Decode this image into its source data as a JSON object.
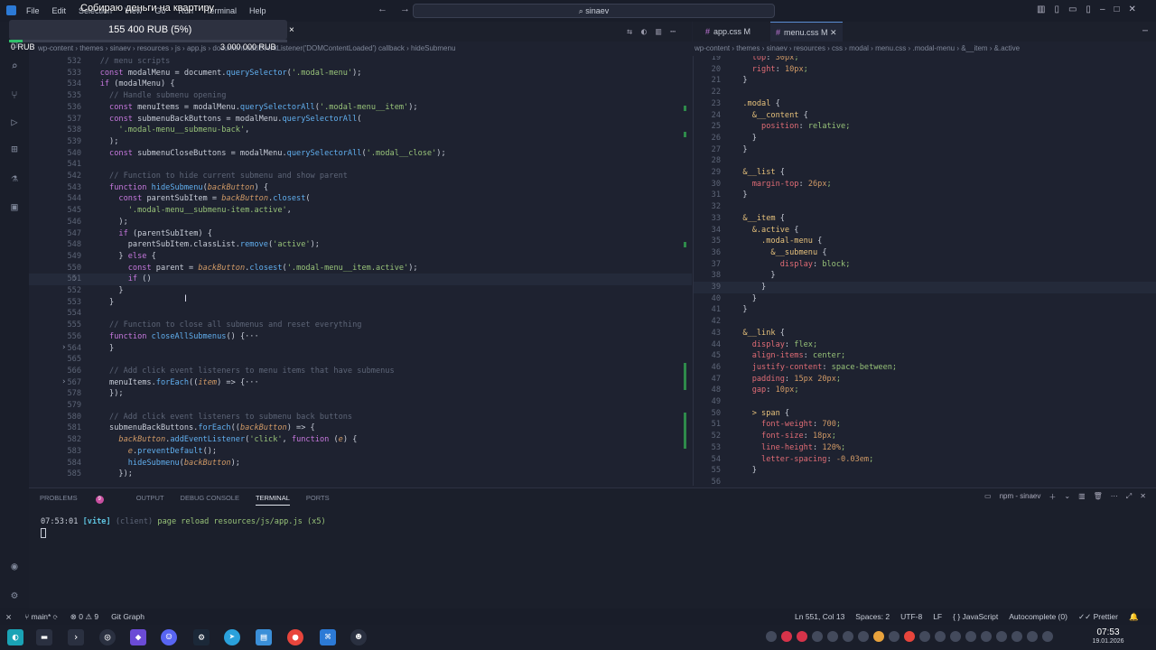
{
  "titlebar": {
    "menu": [
      "File",
      "Edit",
      "Selection",
      "View",
      "Go",
      "Run",
      "Terminal",
      "Help"
    ],
    "search": "sinaev"
  },
  "donation": {
    "title": "Собираю деньги на квартиру",
    "amount": "155 400 RUB (5%)",
    "progress": 0.05,
    "min": "0 RUB",
    "max": "3 000 000 RUB",
    "close": "×"
  },
  "tabs_left": [],
  "tabs_right": [
    {
      "label": "app.css M"
    },
    {
      "label": "menu.css M"
    }
  ],
  "breadcrumb_left": "wp-content › themes › sinaev › resources › js › app.js › document.addEventListener('DOMContentLoaded') callback › hideSubmenu",
  "breadcrumb_right": "wp-content › themes › sinaev › resources › css › modal › menu.css › .modal-menu › &__item › &.active",
  "left_lines": [
    {
      "n": "532",
      "t": "    // menu scripts"
    },
    {
      "n": "533",
      "t": "    const modalMenu = document.querySelector('.modal-menu');"
    },
    {
      "n": "534",
      "t": "    if (modalMenu) {"
    },
    {
      "n": "535",
      "t": "      // Handle submenu opening"
    },
    {
      "n": "536",
      "t": "      const menuItems = modalMenu.querySelectorAll('.modal-menu__item');"
    },
    {
      "n": "537",
      "t": "      const submenuBackButtons = modalMenu.querySelectorAll("
    },
    {
      "n": "538",
      "t": "        '.modal-menu__submenu-back',"
    },
    {
      "n": "539",
      "t": "      );"
    },
    {
      "n": "540",
      "t": "      const submenuCloseButtons = modalMenu.querySelectorAll('.modal__close');"
    },
    {
      "n": "541",
      "t": ""
    },
    {
      "n": "542",
      "t": "      // Function to hide current submenu and show parent"
    },
    {
      "n": "543",
      "t": "      function hideSubmenu(backButton) {"
    },
    {
      "n": "544",
      "t": "        const parentSubItem = backButton.closest("
    },
    {
      "n": "545",
      "t": "          '.modal-menu__submenu-item.active',"
    },
    {
      "n": "546",
      "t": "        );"
    },
    {
      "n": "547",
      "t": "        if (parentSubItem) {"
    },
    {
      "n": "548",
      "t": "          parentSubItem.classList.remove('active');"
    },
    {
      "n": "549",
      "t": "        } else {"
    },
    {
      "n": "550",
      "t": "          const parent = backButton.closest('.modal-menu__item.active');"
    },
    {
      "n": "551",
      "t": "          if ()"
    },
    {
      "n": "552",
      "t": "        }"
    },
    {
      "n": "553",
      "t": "      }"
    },
    {
      "n": "554",
      "t": ""
    },
    {
      "n": "555",
      "t": "      // Function to close all submenus and reset everything"
    },
    {
      "n": "556",
      "t": "      function closeAllSubmenus() {···"
    },
    {
      "n": "564",
      "t": "      }"
    },
    {
      "n": "565",
      "t": ""
    },
    {
      "n": "566",
      "t": "      // Add click event listeners to menu items that have submenus"
    },
    {
      "n": "567",
      "t": "      menuItems.forEach((item) => {···"
    },
    {
      "n": "578",
      "t": "      });"
    },
    {
      "n": "579",
      "t": ""
    },
    {
      "n": "580",
      "t": "      // Add click event listeners to submenu back buttons"
    },
    {
      "n": "581",
      "t": "      submenuBackButtons.forEach((backButton) => {"
    },
    {
      "n": "582",
      "t": "        backButton.addEventListener('click', function (e) {"
    },
    {
      "n": "583",
      "t": "          e.preventDefault();"
    },
    {
      "n": "584",
      "t": "          hideSubmenu(backButton);"
    },
    {
      "n": "585",
      "t": "        });"
    }
  ],
  "right_lines": [
    {
      "n": "19",
      "t": "    top: 30px;"
    },
    {
      "n": "20",
      "t": "    right: 10px;"
    },
    {
      "n": "21",
      "t": "  }"
    },
    {
      "n": "22",
      "t": ""
    },
    {
      "n": "23",
      "t": "  .modal {"
    },
    {
      "n": "24",
      "t": "    &__content {"
    },
    {
      "n": "25",
      "t": "      position: relative;"
    },
    {
      "n": "26",
      "t": "    }"
    },
    {
      "n": "27",
      "t": "  }"
    },
    {
      "n": "28",
      "t": ""
    },
    {
      "n": "29",
      "t": "  &__list {"
    },
    {
      "n": "30",
      "t": "    margin-top: 26px;"
    },
    {
      "n": "31",
      "t": "  }"
    },
    {
      "n": "32",
      "t": ""
    },
    {
      "n": "33",
      "t": "  &__item {"
    },
    {
      "n": "34",
      "t": "    &.active {"
    },
    {
      "n": "35",
      "t": "      .modal-menu {"
    },
    {
      "n": "36",
      "t": "        &__submenu {"
    },
    {
      "n": "37",
      "t": "          display: block;"
    },
    {
      "n": "38",
      "t": "        }"
    },
    {
      "n": "39",
      "t": "      }"
    },
    {
      "n": "40",
      "t": "    }"
    },
    {
      "n": "41",
      "t": "  }"
    },
    {
      "n": "42",
      "t": ""
    },
    {
      "n": "43",
      "t": "  &__link {"
    },
    {
      "n": "44",
      "t": "    display: flex;"
    },
    {
      "n": "45",
      "t": "    align-items: center;"
    },
    {
      "n": "46",
      "t": "    justify-content: space-between;"
    },
    {
      "n": "47",
      "t": "    padding: 15px 20px;"
    },
    {
      "n": "48",
      "t": "    gap: 10px;"
    },
    {
      "n": "49",
      "t": ""
    },
    {
      "n": "50",
      "t": "    > span {"
    },
    {
      "n": "51",
      "t": "      font-weight: 700;"
    },
    {
      "n": "52",
      "t": "      font-size: 18px;"
    },
    {
      "n": "53",
      "t": "      line-height: 120%;"
    },
    {
      "n": "54",
      "t": "      letter-spacing: -0.03em;"
    },
    {
      "n": "55",
      "t": "    }"
    },
    {
      "n": "56",
      "t": ""
    }
  ],
  "panel": {
    "tabs": [
      "PROBLEMS",
      "OUTPUT",
      "DEBUG CONSOLE",
      "TERMINAL",
      "PORTS"
    ],
    "problems_count": "9",
    "active_tab": "TERMINAL",
    "terminal_name": "npm - sinaev",
    "terminal_line": {
      "time": "07:53:01",
      "tag": "[vite]",
      "client": "(client)",
      "msg": "page reload resources/js/app.js (x5)"
    }
  },
  "statusbar": {
    "branch": "main*",
    "errors": "0",
    "warnings": "9",
    "git_graph": "Git Graph",
    "position": "Ln 551, Col 13",
    "spaces": "Spaces: 2",
    "encoding": "UTF-8",
    "eol": "LF",
    "language": "JavaScript",
    "autocomplete": "Autocomplete (0)",
    "prettier": "Prettier"
  },
  "clock": {
    "time": "07:53",
    "date": "19.01.2026"
  }
}
